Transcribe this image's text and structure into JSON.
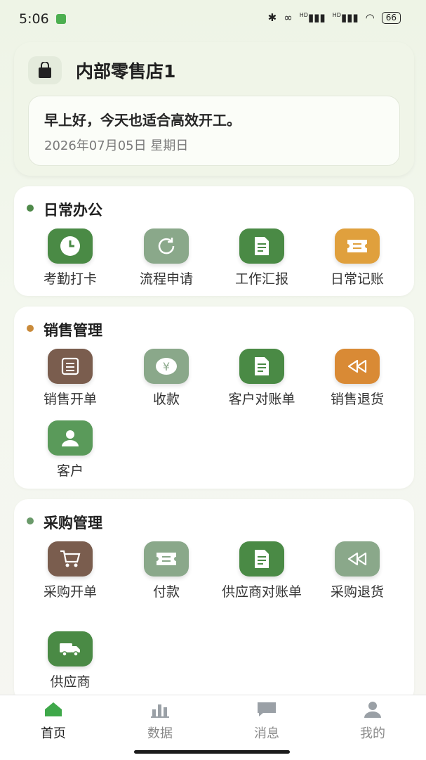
{
  "status_bar": {
    "time": "5:06",
    "signal1": "HD",
    "signal2": "HD",
    "battery": "66"
  },
  "header": {
    "store_name": "内部零售店1",
    "greeting": "早上好，今天也适合高效开工。",
    "date": "2026年07月05日 星期日"
  },
  "sections": [
    {
      "title": "日常办公",
      "dot_color": "#4f8a4a",
      "items": [
        {
          "label": "考勤打卡",
          "icon": "clock-icon",
          "color": "#4a8a45"
        },
        {
          "label": "流程申请",
          "icon": "refresh-icon",
          "color": "#8aa88a"
        },
        {
          "label": "工作汇报",
          "icon": "document-icon",
          "color": "#4a8a45"
        },
        {
          "label": "日常记账",
          "icon": "ticket-icon",
          "color": "#e0a03d"
        }
      ]
    },
    {
      "title": "销售管理",
      "dot_color": "#c98a3a",
      "items": [
        {
          "label": "销售开单",
          "icon": "form-icon",
          "color": "#7a5d4e"
        },
        {
          "label": "收款",
          "icon": "yen-icon",
          "color": "#8aa88a"
        },
        {
          "label": "客户对账单",
          "icon": "document-icon",
          "color": "#4a8a45"
        },
        {
          "label": "销售退货",
          "icon": "rewind-icon",
          "color": "#d98a35"
        },
        {
          "label": "客户",
          "icon": "person-icon",
          "color": "#5a9a5a"
        }
      ]
    },
    {
      "title": "采购管理",
      "dot_color": "#6a9a6a",
      "items": [
        {
          "label": "采购开单",
          "icon": "cart-icon",
          "color": "#7a5d4e"
        },
        {
          "label": "付款",
          "icon": "ticket-icon",
          "color": "#8aa88a"
        },
        {
          "label": "供应商对账单",
          "icon": "document-icon",
          "color": "#4a8a45"
        },
        {
          "label": "采购退货",
          "icon": "rewind-icon",
          "color": "#8aa88a"
        },
        {
          "label": "供应商",
          "icon": "truck-icon",
          "color": "#4a8a45"
        }
      ]
    }
  ],
  "tabs": [
    {
      "label": "首页",
      "icon": "home-icon",
      "active": true
    },
    {
      "label": "数据",
      "icon": "bar-chart-icon",
      "active": false
    },
    {
      "label": "消息",
      "icon": "chat-icon",
      "active": false
    },
    {
      "label": "我的",
      "icon": "user-icon",
      "active": false
    }
  ]
}
